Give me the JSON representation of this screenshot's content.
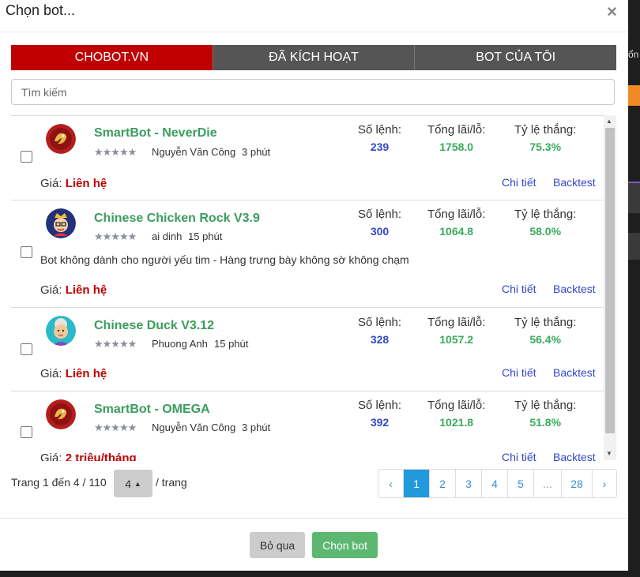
{
  "modal": {
    "title": "Chọn bot...",
    "close": "×"
  },
  "tabs": [
    "CHOBOT.VN",
    "ĐÃ KÍCH HOẠT",
    "BOT CỦA TÔI"
  ],
  "search": {
    "placeholder": "Tìm kiếm"
  },
  "stat_labels": {
    "orders": "Số lệnh:",
    "pnl": "Tổng lãi/lỗ:",
    "winrate": "Tỷ lệ thắng:"
  },
  "price_label": "Giá:",
  "links": {
    "detail": "Chi tiết",
    "backtest": "Backtest"
  },
  "bots": [
    {
      "name": "SmartBot - NeverDie",
      "stars": "★★★★★",
      "author": "Nguyễn Văn Công",
      "time": "3 phút",
      "orders": "239",
      "pnl": "1758.0",
      "winrate": "75.3%",
      "description": "",
      "price": "Liên hệ",
      "avatar": "dragon-avatar"
    },
    {
      "name": "Chinese Chicken Rock V3.9",
      "stars": "★★★★★",
      "author": "ai dinh",
      "time": "15 phút",
      "orders": "300",
      "pnl": "1064.8",
      "winrate": "58.0%",
      "description": "Bot không dành cho người yếu tim - Hàng trưng bày không sờ không chạm",
      "price": "Liên hệ",
      "avatar": "king-avatar"
    },
    {
      "name": "Chinese Duck V3.12",
      "stars": "★★★★★",
      "author": "Phuong Anh",
      "time": "15 phút",
      "orders": "328",
      "pnl": "1057.2",
      "winrate": "56.4%",
      "description": "",
      "price": "Liên hệ",
      "avatar": "grandma-avatar"
    },
    {
      "name": "SmartBot - OMEGA",
      "stars": "★★★★★",
      "author": "Nguyễn Văn Công",
      "time": "3 phút",
      "orders": "392",
      "pnl": "1021.8",
      "winrate": "51.8%",
      "description": "",
      "price": "2 triệu/tháng",
      "avatar": "dragon-avatar"
    }
  ],
  "pagination": {
    "info": "Trang 1 đến 4 / 110",
    "page_size": "4",
    "unit": "/ trang",
    "pages": [
      "‹",
      "1",
      "2",
      "3",
      "4",
      "5",
      "...",
      "28",
      "›"
    ],
    "active": "1"
  },
  "footer": {
    "skip": "Bỏ qua",
    "choose": "Chọn bot"
  },
  "background": {
    "side_text": "ổn"
  }
}
